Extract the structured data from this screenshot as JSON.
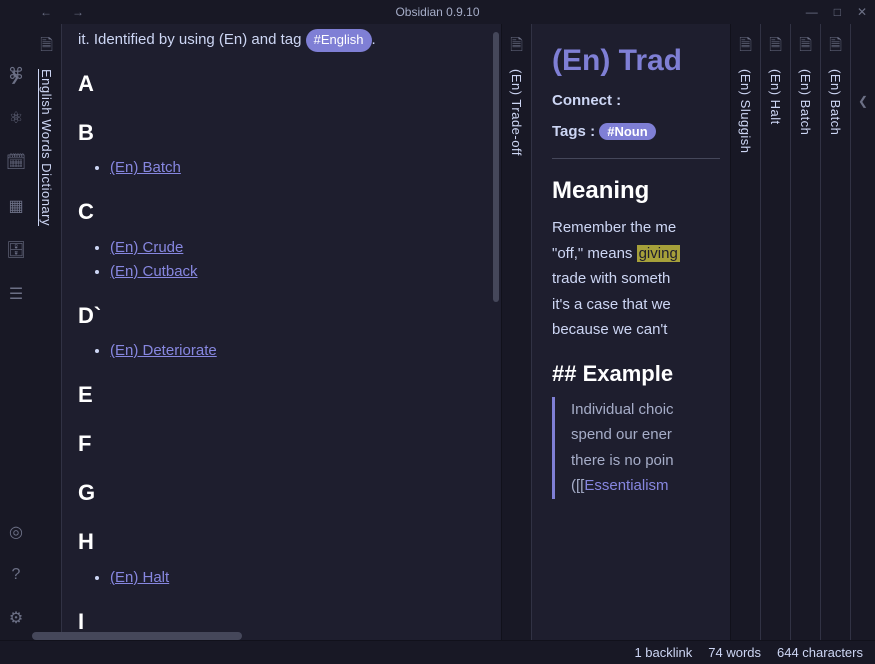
{
  "app": {
    "title": "Obsidian 0.9.10"
  },
  "tabs": {
    "left": "English Words Dictionary",
    "mid": "(En) Trade-off",
    "right": [
      "(En) Sluggish",
      "(En) Halt",
      "(En) Batch",
      "(En) Batch"
    ]
  },
  "dictionary": {
    "intro_prefix": "it. Identified by using (En) and tag ",
    "intro_tag": "#English",
    "intro_suffix": ".",
    "sections": [
      {
        "letter": "A",
        "items": []
      },
      {
        "letter": "B",
        "items": [
          "(En) Batch"
        ]
      },
      {
        "letter": "C",
        "items": [
          "(En) Crude",
          "(En) Cutback"
        ]
      },
      {
        "letter": "D`",
        "items": [
          "(En) Deteriorate"
        ]
      },
      {
        "letter": "E",
        "items": []
      },
      {
        "letter": "F",
        "items": []
      },
      {
        "letter": "G",
        "items": []
      },
      {
        "letter": "H",
        "items": [
          "(En) Halt"
        ]
      },
      {
        "letter": "I",
        "items": []
      }
    ]
  },
  "note": {
    "title": "(En) Trad",
    "connect_label": "Connect :",
    "tags_label": "Tags :",
    "tag_value": "#Noun",
    "meaning_heading": "Meaning",
    "meaning_lines": [
      "Remember the me",
      "\"off,\" means ",
      "trade with someth",
      "it's a case that we",
      "because we can't"
    ],
    "meaning_highlight": "giving",
    "example_heading": "## Example",
    "example_lines": [
      "Individual choic",
      "spend our ener",
      "there is no poin",
      "([["
    ],
    "example_link": "Essentialism"
  },
  "status": {
    "backlinks": "1 backlink",
    "words": "74 words",
    "chars": "644 characters"
  }
}
